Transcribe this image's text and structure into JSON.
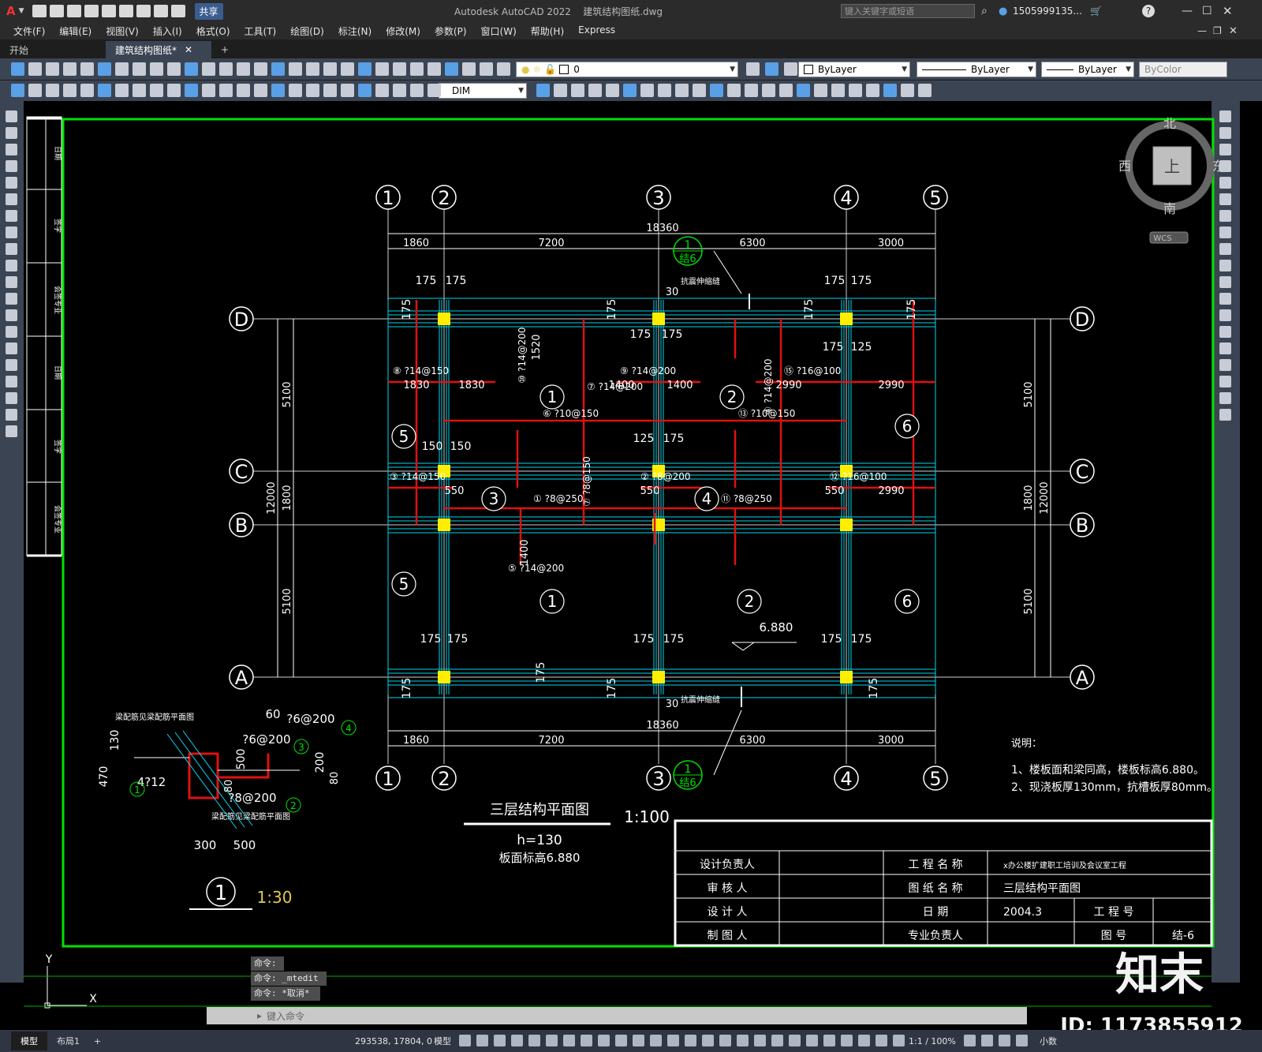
{
  "window": {
    "app_title": "Autodesk AutoCAD 2022",
    "file_name": "建筑结构图纸.dwg",
    "search_placeholder": "键入关键字或短语",
    "user": "1505999135...",
    "share_label": "共享"
  },
  "menu": [
    "文件(F)",
    "编辑(E)",
    "视图(V)",
    "插入(I)",
    "格式(O)",
    "工具(T)",
    "绘图(D)",
    "标注(N)",
    "修改(M)",
    "参数(P)",
    "窗口(W)",
    "帮助(H)",
    "Express"
  ],
  "tabs": {
    "start": "开始",
    "active": "建筑结构图纸*",
    "add": "+"
  },
  "toolbar": {
    "layer_value": "0",
    "color_value": "ByLayer",
    "linetype_value": "ByLayer",
    "lineweight_value": "ByLayer",
    "plotstyle_value": "ByColor",
    "dimstyle_value": "DIM"
  },
  "viewcube": {
    "north": "北",
    "south": "南",
    "east": "东",
    "west": "西",
    "face": "上",
    "wcs": "WCS"
  },
  "drawing": {
    "grid_cols": [
      "1",
      "2",
      "3",
      "4",
      "5"
    ],
    "grid_rows": [
      "D",
      "C",
      "B",
      "A"
    ],
    "overall_width": "18360",
    "bay_dims": [
      "1860",
      "7200",
      "6300",
      "3000"
    ],
    "row_dims": [
      "5100",
      "1800",
      "5100"
    ],
    "overall_height": "12000",
    "elevation": "6.880",
    "expansion_joint": "抗震伸缩缝",
    "col_dims": [
      "175",
      "175",
      "125",
      "150",
      "30"
    ],
    "labels_top": [
      "1830",
      "1830",
      "1400",
      "1400",
      "2990",
      "2990",
      "1520",
      "1400",
      "550",
      "550",
      "550",
      "2990"
    ],
    "rebar_notes": [
      "⑧ ?14@150",
      "⑨ ?14@200",
      "⑮ ?16@100",
      "⑥ ?10@150",
      "⑬ ?10@150",
      "③ ?14@150",
      "② ?8@200",
      "① ?8@250",
      "⑪ ?8@250",
      "⑫ ?16@100",
      "⑩ ?14@200",
      "⑦ ?14@200",
      "⑤ ?14@200",
      "⑦ ?8@150",
      "④ ?14@200"
    ],
    "slab_ids": [
      "1",
      "2",
      "3",
      "4",
      "5",
      "6"
    ],
    "section_callout": {
      "num": "1",
      "sheet": "结6"
    }
  },
  "detail": {
    "title_top": "梁配筋见梁配筋平面图",
    "title_bottom": "梁配筋见梁配筋平面图",
    "dims": [
      "130",
      "470",
      "60",
      "500",
      "200",
      "300",
      "500",
      "80",
      "80"
    ],
    "rebars": [
      "?6@200",
      "?6@200",
      "4?12",
      "?8@200"
    ],
    "tags": [
      "1",
      "2",
      "3",
      "4"
    ],
    "label_num": "1",
    "scale": "1:30"
  },
  "plan_title": {
    "title": "三层结构平面图",
    "scale": "1:100",
    "slab": "h=130",
    "elev": "板面标高6.880"
  },
  "notes": {
    "heading": "说明：",
    "lines": [
      "1、楼板面和梁同高，楼板标高6.880。",
      "2、现浇板厚130mm，抗槽板厚80mm。"
    ]
  },
  "title_block": {
    "row1": [
      "设计负责人",
      "",
      "工 程 名 称",
      "x办公楼扩建职工培训及会议室工程"
    ],
    "row2": [
      "审 核 人",
      "",
      "图 纸 名 称",
      "三层结构平面图"
    ],
    "row3": [
      "设 计 人",
      "",
      "日 期",
      "2004.3",
      "工 程 号",
      ""
    ],
    "row4": [
      "制 图 人",
      "",
      "专业负责人",
      "",
      "图 号",
      "结-6"
    ]
  },
  "left_strip": [
    "日期",
    "签字",
    "会签专业",
    "日期",
    "签字",
    "会签专业"
  ],
  "ucs": {
    "x": "X",
    "y": "Y"
  },
  "command": {
    "lines": [
      "命令:",
      "命令: _mtedit",
      "命令: *取消*"
    ],
    "placeholder": "键入命令"
  },
  "status": {
    "coords": "293538, 17804, 0",
    "model": "模型",
    "scale": "1:1 / 100%",
    "units": "小数"
  },
  "layout_tabs": [
    "模型",
    "布局1",
    "+"
  ],
  "watermark": {
    "brand": "知末",
    "id": "ID: 1173855912"
  },
  "colors": {
    "frame_green": "#00e000",
    "grid_cyan": "#00d6ee",
    "column_yellow": "#ffee00",
    "rebar_red": "#e01010",
    "dim_white": "#e6e6e6",
    "title_blue": "#2b2b2b"
  }
}
